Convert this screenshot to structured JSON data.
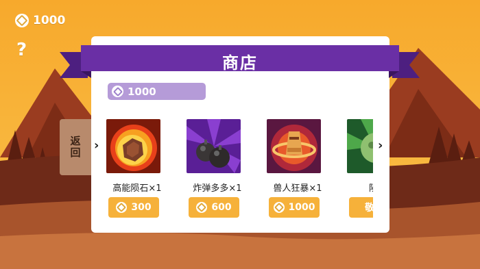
{
  "hud": {
    "coins": "1000",
    "help": "?"
  },
  "back_button": {
    "label": "返回"
  },
  "shop": {
    "title": "商店",
    "balance": "1000",
    "items": [
      {
        "name": "高能陨石×1",
        "price": "300",
        "icon": "meteor-icon"
      },
      {
        "name": "炸弹多多×1",
        "price": "600",
        "icon": "bombs-icon"
      },
      {
        "name": "兽人狂暴×1",
        "price": "1000",
        "icon": "orc-rage-icon"
      },
      {
        "name": "陨石",
        "price": "敬请",
        "icon": "green-meteor-icon"
      }
    ]
  },
  "colors": {
    "sky": "#f4a932",
    "ribbon": "#6a2fa5",
    "price_button": "#f6b13a",
    "balance_bar": "#b59bd8"
  }
}
